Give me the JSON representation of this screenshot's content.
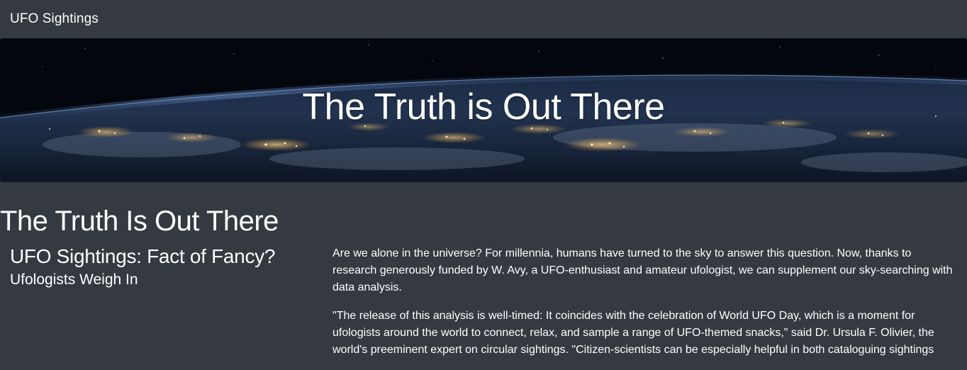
{
  "navbar": {
    "brand": "UFO Sightings"
  },
  "hero": {
    "title": "The Truth is Out There",
    "background": "earth-at-night-from-space"
  },
  "main": {
    "section_title": "The Truth Is Out There",
    "article_title": "UFO Sightings: Fact of Fancy?",
    "article_subtitle": "Ufologists Weigh In",
    "paragraphs": [
      "Are we alone in the universe? For millennia, humans have turned to the sky to answer this question. Now, thanks to research generously funded by W. Avy, a UFO-enthusiast and amateur ufologist, we can supplement our sky-searching with data analysis.",
      "\"The release of this analysis is well-timed: It coincides with the celebration of World UFO Day, which is a moment for ufologists around the world to connect, relax, and sample a range of UFO-themed snacks,\" said Dr. Ursula F. Olivier, the world's preeminent expert on circular sightings. \"Citizen-scientists can be especially helpful in both cataloguing sightings"
    ]
  },
  "colors": {
    "page_background": "#343a40",
    "text": "#ffffff",
    "hero_sky": "#04070f"
  }
}
